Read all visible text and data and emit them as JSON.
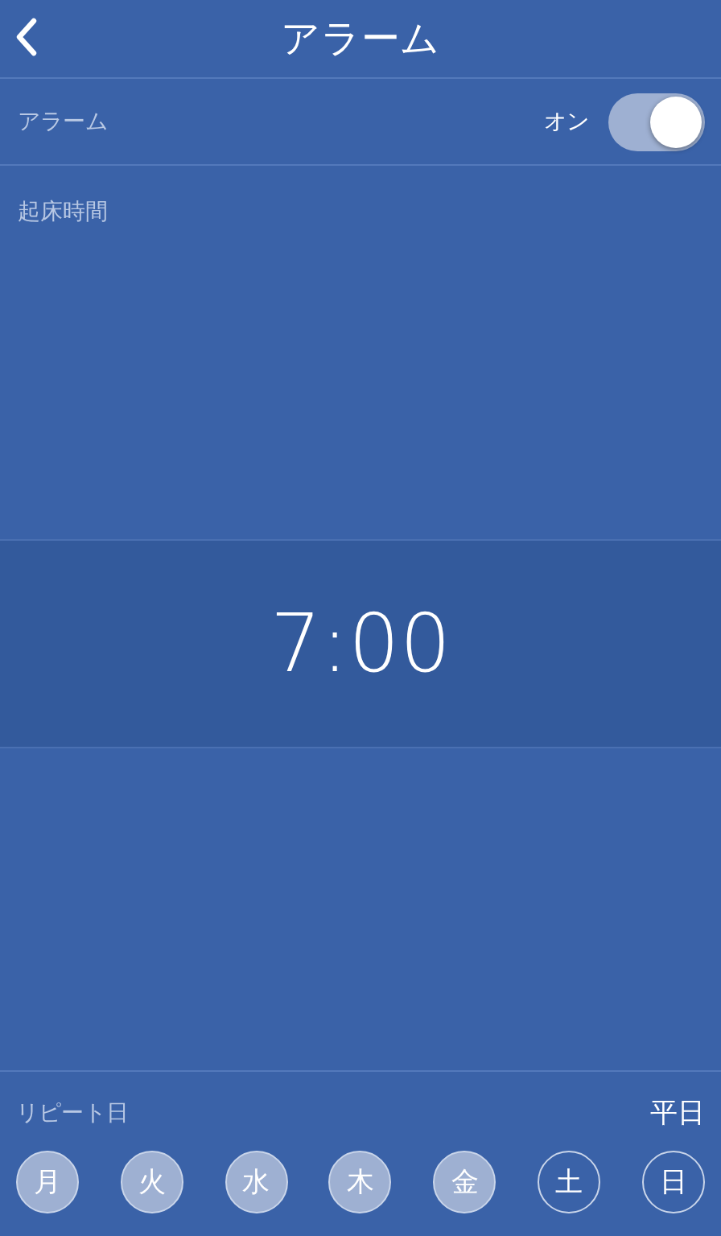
{
  "header": {
    "title": "アラーム"
  },
  "alarm_row": {
    "label": "アラーム",
    "state_text": "オン",
    "on": true
  },
  "wake_time": {
    "label": "起床時間",
    "time": "7:00"
  },
  "repeat": {
    "label": "リピート日",
    "summary": "平日",
    "days": [
      {
        "label": "月",
        "selected": true
      },
      {
        "label": "火",
        "selected": true
      },
      {
        "label": "水",
        "selected": true
      },
      {
        "label": "木",
        "selected": true
      },
      {
        "label": "金",
        "selected": true
      },
      {
        "label": "土",
        "selected": false
      },
      {
        "label": "日",
        "selected": false
      }
    ]
  }
}
